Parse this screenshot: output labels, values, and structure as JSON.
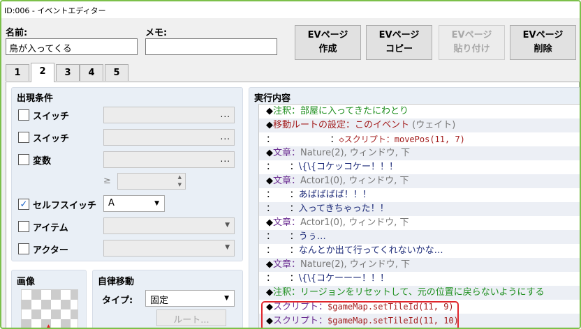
{
  "window": {
    "title": "ID:006 - イベントエディター"
  },
  "name": {
    "label": "名前:",
    "value": "鳥が入ってくる"
  },
  "memo": {
    "label": "メモ:",
    "value": ""
  },
  "page_buttons": [
    {
      "line1": "EVページ",
      "line2": "作成"
    },
    {
      "line1": "EVページ",
      "line2": "コピー"
    },
    {
      "line1": "EVページ",
      "line2": "貼り付け"
    },
    {
      "line1": "EVページ",
      "line2": "削除"
    }
  ],
  "tabs": [
    "1",
    "2",
    "3",
    "4",
    "5"
  ],
  "active_tab": "2",
  "conditions": {
    "title": "出現条件",
    "switch1": {
      "label": "スイッチ",
      "checked": false,
      "button": "..."
    },
    "switch2": {
      "label": "スイッチ",
      "checked": false,
      "button": "..."
    },
    "variable": {
      "label": "変数",
      "checked": false,
      "button": "...",
      "operator": "≥"
    },
    "self_switch": {
      "label": "セルフスイッチ",
      "checked": true,
      "value": "A"
    },
    "item": {
      "label": "アイテム",
      "checked": false
    },
    "actor": {
      "label": "アクター",
      "checked": false
    }
  },
  "image": {
    "title": "画像"
  },
  "autonomous": {
    "title": "自律移動",
    "type_label": "タイプ:",
    "type_value": "固定",
    "route_button": "ルート..."
  },
  "contents": {
    "title": "実行内容",
    "rows": [
      {
        "d": "◆",
        "cmd": "注釈",
        "sep": "：",
        "arg": "部屋に入ってきたにわとり",
        "cmd_class": "c-comment",
        "arg_class": "c-comment"
      },
      {
        "d": "◆",
        "cmd": "移動ルートの設定",
        "sep": "：",
        "arg": "このイベント",
        "extra": " (ウェイト)",
        "cmd_class": "c-move",
        "arg_class": "c-move"
      },
      {
        "d": "",
        "cmd": "",
        "sep": "：",
        "indent": "                   ：",
        "arg": "◇スクリプト：movePos(11, 7)",
        "arg_class": "c-move"
      },
      {
        "d": "◆",
        "cmd": "文章",
        "sep": "：",
        "arg": "Nature(2), ウィンドウ, 下",
        "cmd_class": "c-text",
        "arg_class": "c-gray"
      },
      {
        "d": "",
        "cmd": "",
        "sep": "：",
        "indent": "     ：",
        "arg": "\\{\\{コケッコケー！！！",
        "arg_class": "c-navy"
      },
      {
        "d": "◆",
        "cmd": "文章",
        "sep": "：",
        "arg": "Actor1(0), ウィンドウ, 下",
        "cmd_class": "c-text",
        "arg_class": "c-gray"
      },
      {
        "d": "",
        "cmd": "",
        "sep": "：",
        "indent": "     ：",
        "arg": "あばばばば！！！",
        "arg_class": "c-navy"
      },
      {
        "d": "",
        "cmd": "",
        "sep": "：",
        "indent": "     ：",
        "arg": "入ってきちゃった！！",
        "arg_class": "c-navy"
      },
      {
        "d": "◆",
        "cmd": "文章",
        "sep": "：",
        "arg": "Actor1(0), ウィンドウ, 下",
        "cmd_class": "c-text",
        "arg_class": "c-gray"
      },
      {
        "d": "",
        "cmd": "",
        "sep": "：",
        "indent": "     ：",
        "arg": "うぅ…",
        "arg_class": "c-navy"
      },
      {
        "d": "",
        "cmd": "",
        "sep": "：",
        "indent": "     ：",
        "arg": "なんとか出て行ってくれないかな…",
        "arg_class": "c-navy"
      },
      {
        "d": "◆",
        "cmd": "文章",
        "sep": "：",
        "arg": "Nature(2), ウィンドウ, 下",
        "cmd_class": "c-text",
        "arg_class": "c-gray"
      },
      {
        "d": "",
        "cmd": "",
        "sep": "：",
        "indent": "     ：",
        "arg": "\\{\\{コケーーー！！！",
        "arg_class": "c-navy"
      },
      {
        "d": "◆",
        "cmd": "注釈",
        "sep": "：",
        "arg": "リージョンをリセットして、元の位置に戻らないようにする",
        "cmd_class": "c-comment",
        "arg_class": "c-comment"
      },
      {
        "d": "◆",
        "cmd": "スクリプト",
        "sep": "：",
        "arg": "$gameMap.setTileId(11, 9)",
        "cmd_class": "c-text",
        "arg_class": "c-script"
      },
      {
        "d": "◆",
        "cmd": "スクリプト",
        "sep": "：",
        "arg": "$gameMap.setTileId(11, 10)",
        "cmd_class": "c-text",
        "arg_class": "c-script"
      }
    ]
  },
  "colors": {
    "frame": "#7cc04a",
    "highlight": "#e0262c",
    "comment": "#1e8f1e",
    "move": "#a31d1d",
    "text_cmd": "#6a2c91",
    "message": "#1c2a78"
  }
}
